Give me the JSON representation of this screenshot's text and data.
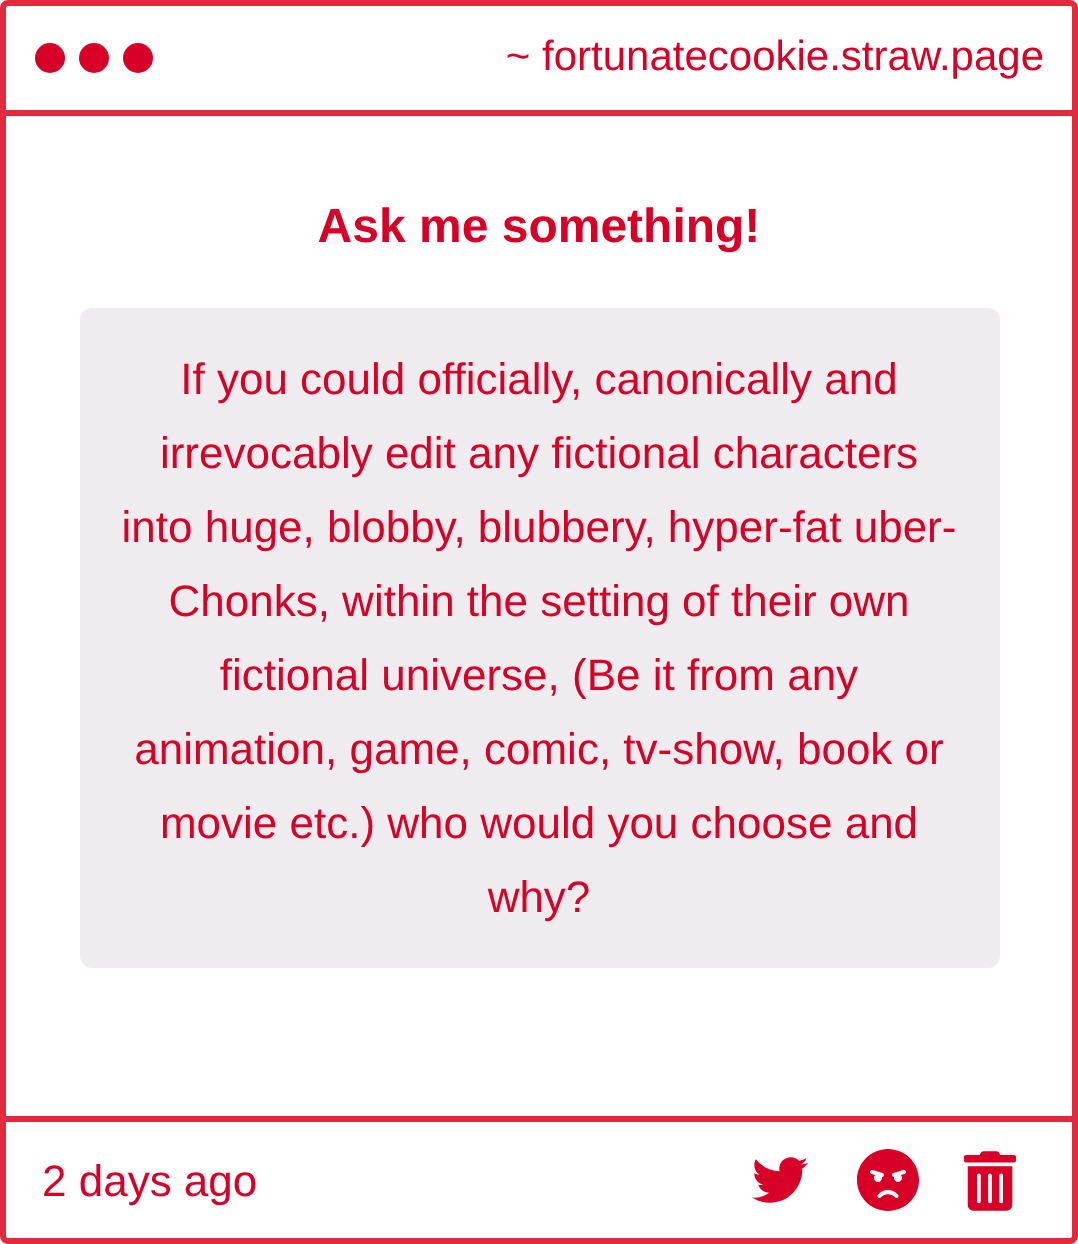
{
  "window": {
    "address": "~ fortunatecookie.straw.page"
  },
  "title": "Ask me something!",
  "question": "If you could officially, canonically and irrevocably edit any fictional characters into huge, blobby, blubbery, hyper-fat uber-Chonks, within the setting of their own fictional universe, (Be it from any animation, game, comic, tv-show, book or movie etc.) who would you choose and why?",
  "footer": {
    "time": "2 days ago"
  }
}
